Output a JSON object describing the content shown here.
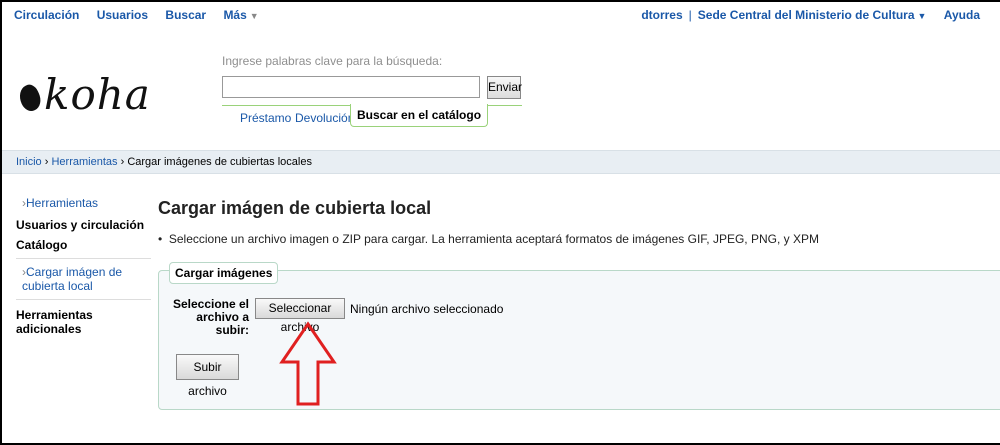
{
  "topnav": {
    "items": [
      "Circulación",
      "Usuarios",
      "Buscar",
      "Más"
    ],
    "user": "dtorres",
    "branch": "Sede Central del Ministerio de Cultura",
    "help": "Ayuda"
  },
  "logo": {
    "text": "koha"
  },
  "search": {
    "label": "Ingrese palabras clave para la búsqueda:",
    "value": "",
    "submit": "Enviar",
    "tabs": [
      "Préstamo",
      "Devolución",
      "Buscar en el catálogo"
    ],
    "active_tab": "Buscar en el catálogo"
  },
  "breadcrumb": {
    "items": [
      "Inicio",
      "Herramientas",
      "Cargar imágenes de cubiertas locales"
    ],
    "separator": "›"
  },
  "sidebar": {
    "items": [
      {
        "label": "Herramientas",
        "type": "link"
      },
      {
        "label": "Usuarios y circulación",
        "type": "heading"
      },
      {
        "label": "Catálogo",
        "type": "heading"
      },
      {
        "label": "Cargar imágen de cubierta local",
        "type": "link"
      },
      {
        "label": "Herramientas adicionales",
        "type": "heading"
      }
    ]
  },
  "main": {
    "title": "Cargar imágen de cubierta local",
    "intro": "Seleccione un archivo imagen o ZIP para cargar. La herramienta aceptará formatos de imágenes GIF, JPEG, PNG, y XPM",
    "fieldset_legend": "Cargar imágenes",
    "file_label": "Seleccione el archivo a subir:",
    "file_button": "Seleccionar archivo",
    "file_status": "Ningún archivo seleccionado",
    "submit_button": "Subir archivo"
  },
  "annotation": {
    "arrow_color": "#e02020",
    "icon": "arrow-up-icon"
  },
  "colors": {
    "link": "#1a58a8",
    "accent_green": "#9ad27a",
    "breadcrumb_bg": "#e8eef3"
  }
}
